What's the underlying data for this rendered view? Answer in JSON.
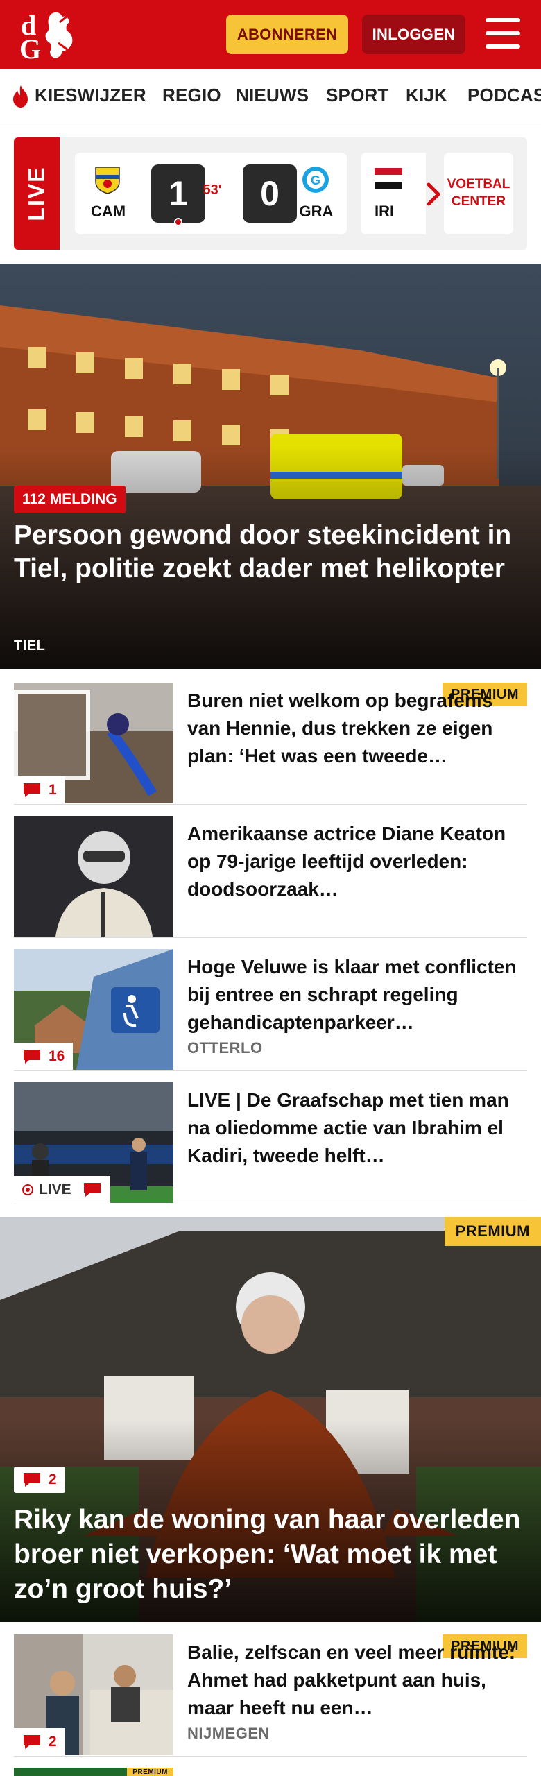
{
  "header": {
    "logo_text": "dG",
    "subscribe_label": "ABONNEREN",
    "login_label": "INLOGGEN"
  },
  "nav": {
    "items": [
      "KIESWIJZER",
      "REGIO",
      "NIEUWS",
      "SPORT",
      "KIJK",
      "PODCAS"
    ]
  },
  "livebar": {
    "live_label": "LIVE",
    "match": {
      "home": "CAM",
      "away": "GRA",
      "home_score": "1",
      "away_score": "0",
      "minute": "53'"
    },
    "next_team": "IRI",
    "voetbalcenter": [
      "VOETBAL",
      "CENTER"
    ]
  },
  "hero": {
    "tag": "112 MELDING",
    "title": "Persoon gewond door steekincident in Tiel, politie zoekt dader met helikopter",
    "location": "TIEL"
  },
  "articles": [
    {
      "title": "Buren niet welkom op begrafenis van Hennie, dus trekken ze eigen plan: ‘Het was een tweede…",
      "premium": "PREMIUM",
      "comments": "1",
      "location": ""
    },
    {
      "title": "Amerikaanse actrice Diane Keaton op 79-jarige leeftijd overleden: doodsoorzaak…",
      "premium": "",
      "comments": "",
      "location": ""
    },
    {
      "title": "Hoge Veluwe is klaar met conflicten bij entree en schrapt regeling gehandicaptenparkeer…",
      "premium": "",
      "comments": "16",
      "location": "OTTERLO"
    },
    {
      "title": "LIVE | De Graafschap met tien man na oliedomme actie van Ibrahim el Kadiri, tweede helft…",
      "premium": "",
      "comments": "",
      "live": "LIVE",
      "location": ""
    }
  ],
  "hero2": {
    "premium": "PREMIUM",
    "comments": "2",
    "title": "Riky kan de woning van haar overleden broer niet verkopen: ‘Wat moet ik met zo’n groot huis?’"
  },
  "article5": {
    "title": "Balie, zelfscan en veel meer ruimte: Ahmet had pakketpunt aan huis, maar heeft nu een…",
    "premium": "PREMIUM",
    "comments": "2",
    "location": "NIJMEGEN"
  },
  "article6": {
    "premium": "PREMIUM"
  },
  "colors": {
    "brand_red": "#d20a11",
    "premium_yellow": "#f8c437",
    "login_dark_red": "#9e0b12"
  }
}
